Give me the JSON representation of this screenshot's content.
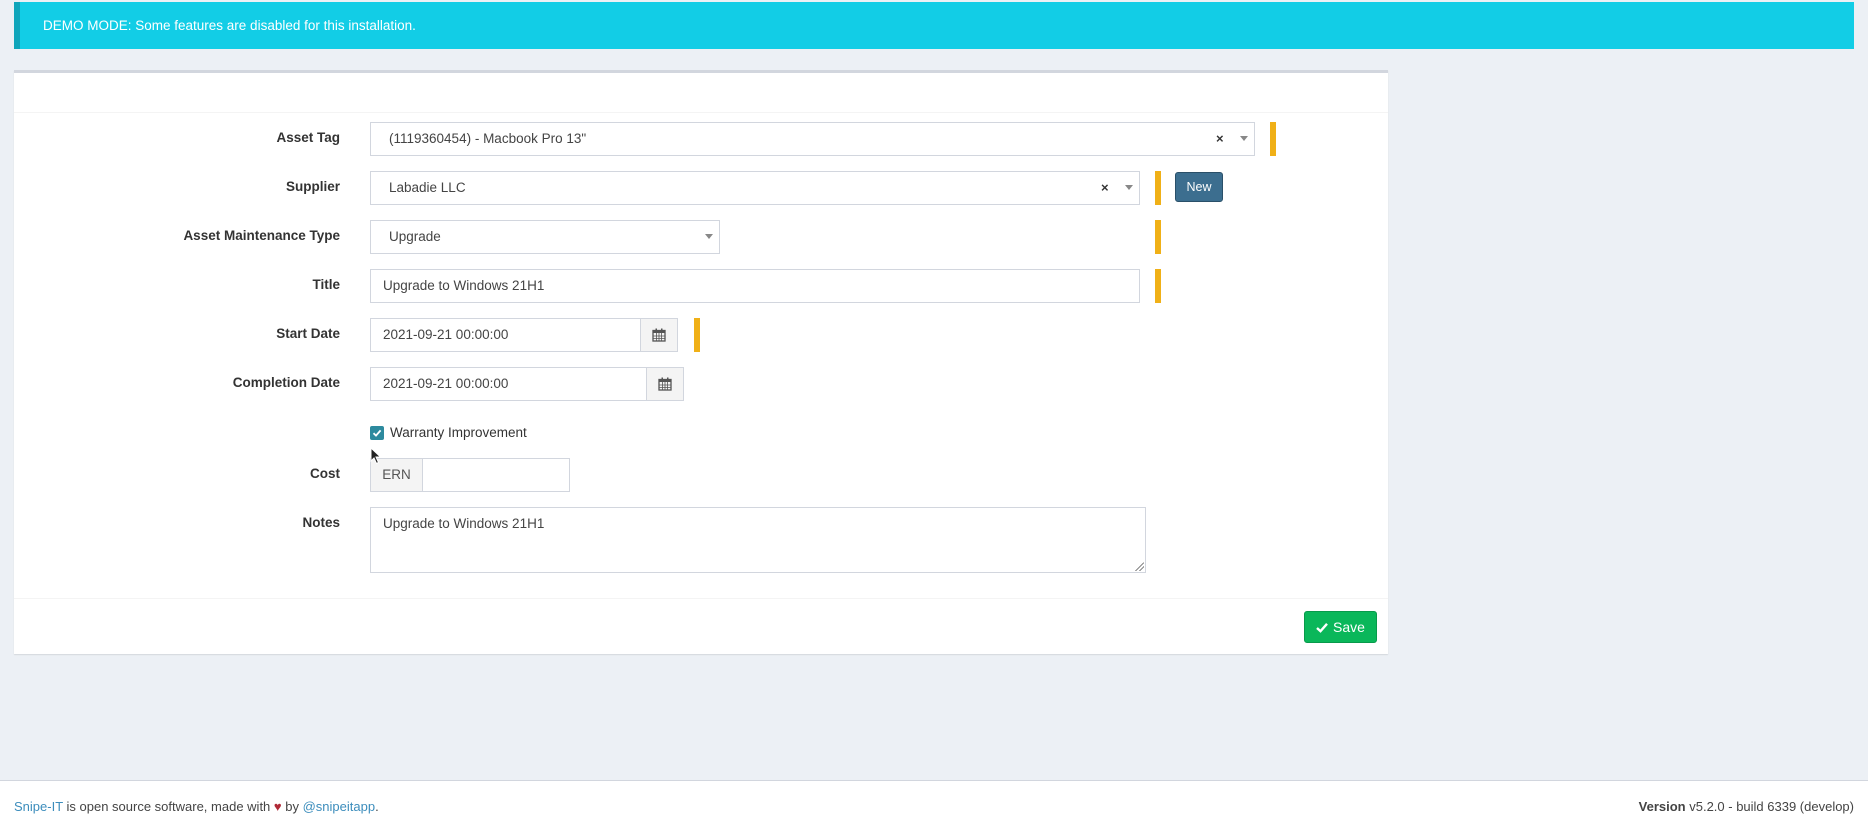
{
  "alert": {
    "text": "DEMO MODE: Some features are disabled for this installation."
  },
  "form": {
    "asset_tag": {
      "label": "Asset Tag",
      "value": "(1119360454) - Macbook Pro 13\""
    },
    "supplier": {
      "label": "Supplier",
      "value": "Labadie LLC",
      "new_button": "New"
    },
    "maintenance_type": {
      "label": "Asset Maintenance Type",
      "value": "Upgrade"
    },
    "title": {
      "label": "Title",
      "value": "Upgrade to Windows 21H1"
    },
    "start_date": {
      "label": "Start Date",
      "value": "2021-09-21 00:00:00"
    },
    "completion_date": {
      "label": "Completion Date",
      "value": "2021-09-21 00:00:00"
    },
    "warranty": {
      "label": "Warranty Improvement",
      "checked": true
    },
    "cost": {
      "label": "Cost",
      "currency": "ERN",
      "value": ""
    },
    "notes": {
      "label": "Notes",
      "value": "Upgrade to Windows 21H1"
    },
    "save_label": "Save",
    "clear_glyph": "×"
  },
  "colors": {
    "alert_bg": "#12cde6",
    "required_marker": "#f0b017",
    "save_button": "#0ab75a",
    "new_button": "#3c6e8f",
    "link": "#3c8dbc"
  },
  "footer": {
    "brand_link": "Snipe-IT",
    "text_mid": " is open source software, made with ",
    "heart": "♥",
    "text_by": " by ",
    "author_link": "@snipeitapp",
    "period": ".",
    "version_label": "Version",
    "version_value": " v5.2.0 - build 6339 (develop)"
  }
}
